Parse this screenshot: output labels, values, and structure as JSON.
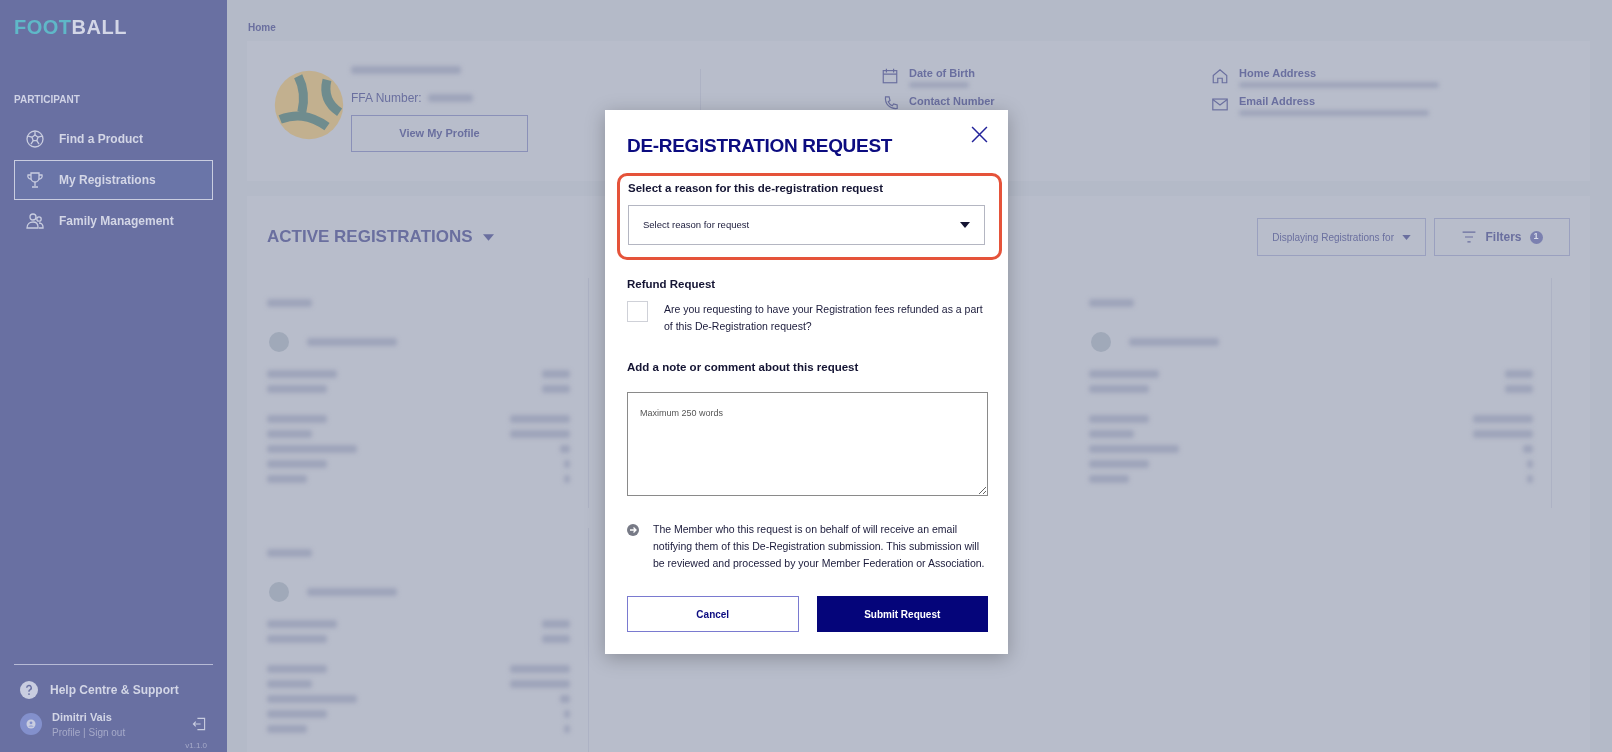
{
  "sidebar": {
    "logo": {
      "accent": "FOOT",
      "rest": "BALL"
    },
    "section": "PARTICIPANT",
    "items": [
      {
        "label": "Find a Product",
        "selected": false
      },
      {
        "label": "My Registrations",
        "selected": true
      },
      {
        "label": "Family Management",
        "selected": false
      }
    ],
    "help": "Help Centre & Support",
    "user": {
      "name": "Dimitri Vais",
      "links": "Profile | Sign out"
    },
    "version": "v1.1.0"
  },
  "breadcrumb": "Home",
  "profile": {
    "ffa_label": "FFA Number:",
    "button": "View My Profile",
    "fields": [
      {
        "label": "Date of Birth"
      },
      {
        "label": "Contact Number"
      },
      {
        "label": "Home Address"
      },
      {
        "label": "Email Address"
      }
    ]
  },
  "registrations": {
    "title": "ACTIVE REGISTRATIONS",
    "display_button": "Displaying Registrations for",
    "filters_button": "Filters",
    "filter_count": "1"
  },
  "modal": {
    "title": "DE-REGISTRATION REQUEST",
    "reason": {
      "label": "Select a reason for this de-registration request",
      "placeholder": "Select reason for request",
      "highlighted": true
    },
    "refund": {
      "label": "Refund Request",
      "text": "Are you requesting to have your Registration fees refunded as a part of this De-Registration request?",
      "checked": false
    },
    "note": {
      "label": "Add a note or comment about this request",
      "placeholder": "Maximum 250 words"
    },
    "info": "The Member who this request is on behalf of will receive an email notifying them of this De-Registration submission. This submission will be reviewed and processed by your Member Federation or Association.",
    "buttons": [
      {
        "label": "Cancel",
        "kind": "secondary"
      },
      {
        "label": "Submit Request",
        "kind": "primary"
      }
    ]
  }
}
